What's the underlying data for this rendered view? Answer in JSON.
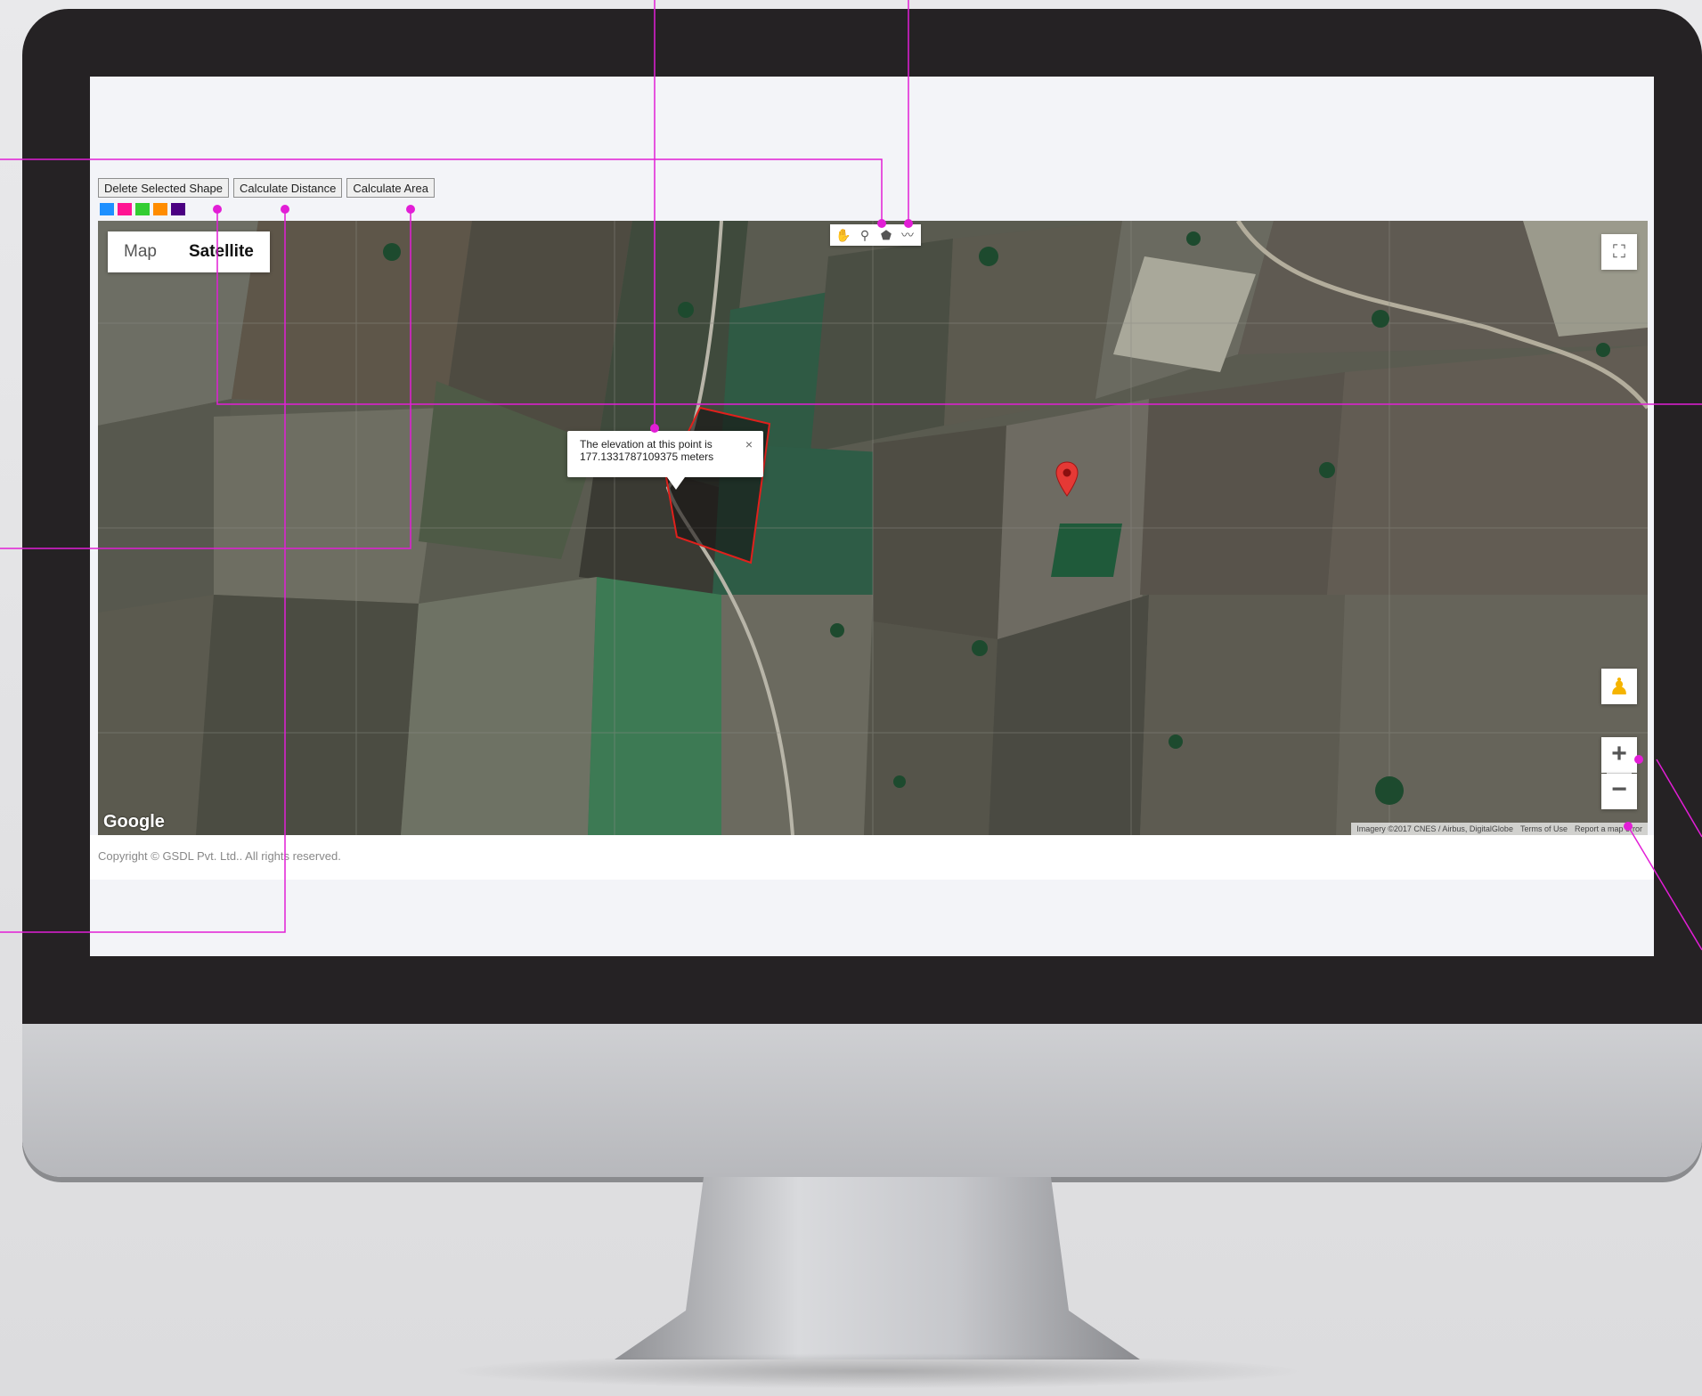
{
  "toolbar": {
    "delete_label": "Delete Selected Shape",
    "distance_label": "Calculate Distance",
    "area_label": "Calculate Area"
  },
  "palette": {
    "colors": [
      "#1e90ff",
      "#ff1493",
      "#32cd32",
      "#ff8c00",
      "#4b0082"
    ]
  },
  "map": {
    "type_map_label": "Map",
    "type_satellite_label": "Satellite",
    "active_type": "Satellite",
    "draw_tools": [
      "hand-icon",
      "marker-icon",
      "polygon-icon",
      "polyline-icon"
    ],
    "infowindow": {
      "text": "The elevation at this point is 177.1331787109375 meters",
      "close": "×"
    },
    "polygon_color": "#e0201c",
    "marker_color": "#e53935",
    "google_logo": "Google",
    "attribution": {
      "imagery": "Imagery ©2017 CNES / Airbus, DigitalGlobe",
      "terms": "Terms of Use",
      "report": "Report a map error"
    },
    "zoom_in": "+",
    "zoom_out": "−"
  },
  "footer": {
    "copyright": "Copyright © GSDL Pvt. Ltd.. All rights reserved."
  },
  "callout_color": "#e21ed6"
}
